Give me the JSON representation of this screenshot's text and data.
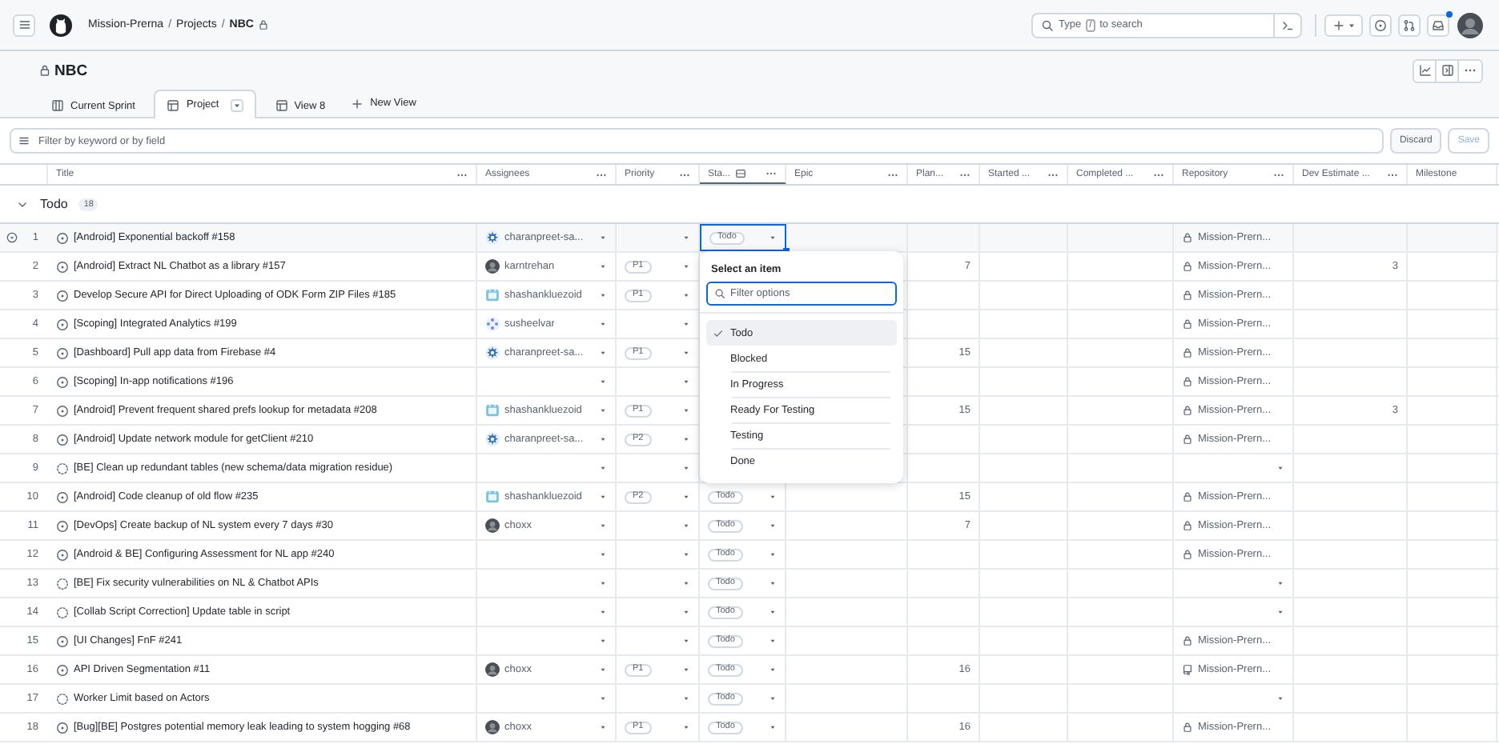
{
  "header": {
    "breadcrumb": [
      {
        "label": "Mission-Prerna",
        "locked": false
      },
      {
        "separator": "/",
        "label": "Projects",
        "locked": false
      },
      {
        "separator": "/",
        "label": "NBC",
        "locked": true
      }
    ],
    "search": {
      "before": "Type",
      "key": "/",
      "after": "to search"
    },
    "inbox_unread": true
  },
  "project": {
    "title": "NBC",
    "locked": true
  },
  "tabs": [
    {
      "label": "Current Sprint",
      "kind": "board",
      "selected": false
    },
    {
      "label": "Project",
      "kind": "table",
      "selected": true
    },
    {
      "label": "View 8",
      "kind": "table",
      "selected": false
    }
  ],
  "new_view": "New View",
  "filter": {
    "placeholder": "Filter by keyword or by field"
  },
  "filter_buttons": [
    {
      "label": "Discard",
      "disabled": false
    },
    {
      "label": "Save",
      "disabled": true
    }
  ],
  "columns": [
    {
      "label": "Title",
      "menu": true,
      "grouped": false
    },
    {
      "label": "Assignees",
      "menu": true,
      "grouped": false
    },
    {
      "label": "Priority",
      "menu": true,
      "grouped": false
    },
    {
      "label": "Sta...",
      "menu": true,
      "grouped": true
    },
    {
      "label": "Epic",
      "menu": true,
      "grouped": false
    },
    {
      "label": "Plan...",
      "menu": true,
      "grouped": false
    },
    {
      "label": "Started ...",
      "menu": true,
      "grouped": false
    },
    {
      "label": "Completed ...",
      "menu": true,
      "grouped": false
    },
    {
      "label": "Repository",
      "menu": true,
      "grouped": false
    },
    {
      "label": "Dev Estimate ...",
      "menu": true,
      "grouped": false
    },
    {
      "label": "Milestone",
      "menu": false,
      "grouped": false
    }
  ],
  "group": {
    "label": "Todo",
    "count": "18",
    "expanded": true
  },
  "rows": [
    {
      "number": "1",
      "kind": "issue",
      "title": "[Android] Exponential backoff #158",
      "selected": true,
      "assignee": {
        "name": "charanpreet-sa...",
        "kind": "gear"
      },
      "status": "Todo",
      "repository": {
        "name": "Mission-Prern...",
        "kind": "lock"
      }
    },
    {
      "number": "2",
      "kind": "issue",
      "title": "[Android] Extract NL Chatbot as a library #157",
      "selected": false,
      "assignee": {
        "name": "karntrehan",
        "kind": "photo"
      },
      "priority": "P1",
      "plan": "7",
      "repository": {
        "name": "Mission-Prern...",
        "kind": "lock"
      },
      "estimate": "3"
    },
    {
      "number": "3",
      "kind": "issue",
      "title": "Develop Secure API for Direct Uploading of ODK Form ZIP Files #185",
      "selected": false,
      "assignee": {
        "name": "shashankluezoid",
        "kind": "calendar"
      },
      "priority": "P1",
      "repository": {
        "name": "Mission-Prern...",
        "kind": "lock"
      }
    },
    {
      "number": "4",
      "kind": "issue",
      "title": "[Scoping] Integrated Analytics #199",
      "selected": false,
      "assignee": {
        "name": "susheelvar",
        "kind": "dots"
      },
      "repository": {
        "name": "Mission-Prern...",
        "kind": "lock"
      }
    },
    {
      "number": "5",
      "kind": "issue",
      "title": "[Dashboard] Pull app data from Firebase #4",
      "selected": false,
      "assignee": {
        "name": "charanpreet-sa...",
        "kind": "gear"
      },
      "priority": "P1",
      "plan": "15",
      "repository": {
        "name": "Mission-Prern...",
        "kind": "lock"
      }
    },
    {
      "number": "6",
      "kind": "issue",
      "title": "[Scoping] In-app notifications #196",
      "selected": false,
      "repository": {
        "name": "Mission-Prern...",
        "kind": "lock"
      }
    },
    {
      "number": "7",
      "kind": "issue",
      "title": "[Android] Prevent frequent shared prefs lookup for metadata #208",
      "selected": false,
      "assignee": {
        "name": "shashankluezoid",
        "kind": "calendar"
      },
      "priority": "P1",
      "plan": "15",
      "repository": {
        "name": "Mission-Prern...",
        "kind": "lock"
      },
      "estimate": "3"
    },
    {
      "number": "8",
      "kind": "issue",
      "title": "[Android] Update network module for getClient #210",
      "selected": false,
      "assignee": {
        "name": "charanpreet-sa...",
        "kind": "gear"
      },
      "priority": "P2",
      "repository": {
        "name": "Mission-Prern...",
        "kind": "lock"
      }
    },
    {
      "number": "9",
      "kind": "draft",
      "title": "[BE] Clean up redundant tables (new schema/data migration residue)",
      "selected": false
    },
    {
      "number": "10",
      "kind": "issue",
      "title": "[Android] Code cleanup of old flow #235",
      "selected": false,
      "assignee": {
        "name": "shashankluezoid",
        "kind": "calendar"
      },
      "priority": "P2",
      "status": "Todo",
      "plan": "15",
      "repository": {
        "name": "Mission-Prern...",
        "kind": "lock"
      }
    },
    {
      "number": "11",
      "kind": "issue",
      "title": "[DevOps] Create backup of NL system every 7 days #30",
      "selected": false,
      "assignee": {
        "name": "choxx",
        "kind": "photo"
      },
      "status": "Todo",
      "plan": "7",
      "repository": {
        "name": "Mission-Prern...",
        "kind": "lock"
      }
    },
    {
      "number": "12",
      "kind": "issue",
      "title": "[Android & BE] Configuring Assessment for NL app #240",
      "selected": false,
      "status": "Todo",
      "repository": {
        "name": "Mission-Prern...",
        "kind": "lock"
      }
    },
    {
      "number": "13",
      "kind": "draft",
      "title": "[BE] Fix security vulnerabilities on NL & Chatbot APIs",
      "selected": false,
      "status": "Todo"
    },
    {
      "number": "14",
      "kind": "draft",
      "title": "[Collab Script Correction] Update table in script",
      "selected": false,
      "status": "Todo"
    },
    {
      "number": "15",
      "kind": "issue",
      "title": "[UI Changes] FnF #241",
      "selected": false,
      "status": "Todo",
      "repository": {
        "name": "Mission-Prern...",
        "kind": "lock"
      }
    },
    {
      "number": "16",
      "kind": "issue",
      "title": "API Driven Segmentation #11",
      "selected": false,
      "assignee": {
        "name": "choxx",
        "kind": "photo"
      },
      "priority": "P1",
      "status": "Todo",
      "plan": "16",
      "repository": {
        "name": "Mission-Prern...",
        "kind": "book"
      }
    },
    {
      "number": "17",
      "kind": "draft",
      "title": "Worker Limit based on Actors",
      "selected": false,
      "status": "Todo"
    },
    {
      "number": "18",
      "kind": "issue",
      "title": "[Bug][BE] Postgres potential memory leak leading to system hogging #68",
      "selected": false,
      "assignee": {
        "name": "choxx",
        "kind": "photo"
      },
      "priority": "P1",
      "status": "Todo",
      "plan": "16",
      "repository": {
        "name": "Mission-Prern...",
        "kind": "lock"
      }
    }
  ],
  "menu": {
    "heading": "Select an item",
    "placeholder": "Filter options",
    "options": [
      {
        "label": "Todo",
        "selected": true
      },
      {
        "label": "Blocked",
        "selected": false
      },
      {
        "label": "In Progress",
        "selected": false
      },
      {
        "label": "Ready For Testing",
        "selected": false
      },
      {
        "label": "Testing",
        "selected": false
      },
      {
        "label": "Done",
        "selected": false
      }
    ]
  }
}
